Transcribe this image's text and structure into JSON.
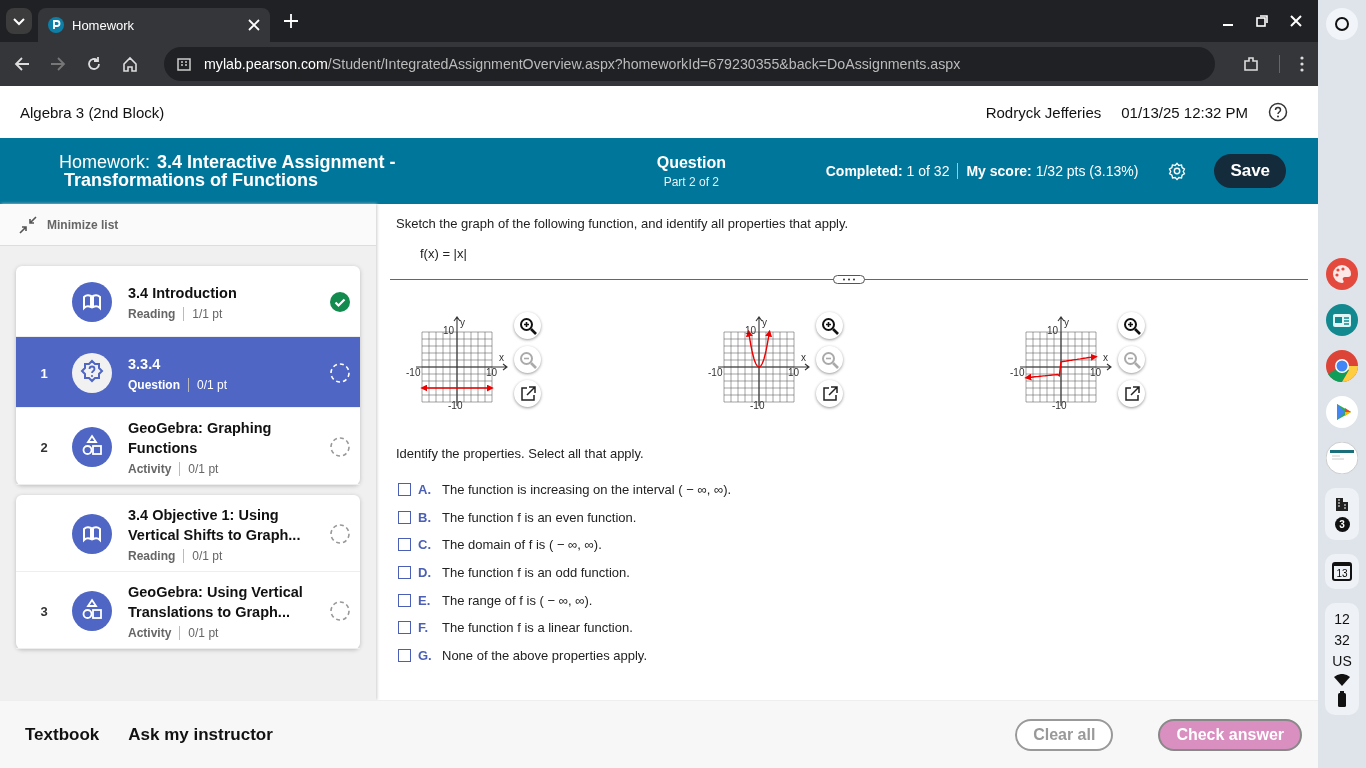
{
  "browser": {
    "tab": {
      "title": "Homework",
      "selected": true
    },
    "url_host": "mylab.pearson.com",
    "url_path": "/Student/IntegratedAssignmentOverview.aspx?homeworkId=679230355&back=DoAssignments.aspx"
  },
  "header": {
    "course": "Algebra 3 (2nd Block)",
    "user": "Rodryck Jefferies",
    "datetime": "01/13/25 12:32 PM"
  },
  "assignment_bar": {
    "prefix": "Homework:",
    "title": "3.4 Interactive Assignment -",
    "title_line2": "Transformations of Functions",
    "question_label": "Question",
    "part": "Part 2 of 2",
    "completed": "**Completed:** 1 of 32",
    "score": "**My score:** 1/32 pts (3.13%)",
    "save": "Save"
  },
  "sidebar": {
    "minimize": "Minimize list",
    "groups": [
      {
        "items": [
          {
            "kind": "reading",
            "title": "3.4 Introduction",
            "type": "Reading",
            "points": "1/1 pt",
            "complete": true,
            "selected": false
          },
          {
            "number": "1",
            "kind": "question",
            "title": "3.3.4",
            "type": "Question",
            "points": "0/1 pt",
            "complete": false,
            "selected": true
          },
          {
            "number": "2",
            "kind": "activity",
            "title": "GeoGebra: Graphing Functions",
            "type": "Activity",
            "points": "0/1 pt",
            "complete": false,
            "selected": false
          }
        ]
      },
      {
        "items": [
          {
            "kind": "reading",
            "title": "3.4 Objective 1: Using Vertical Shifts to Graph...",
            "type": "Reading",
            "points": "0/1 pt",
            "complete": false,
            "selected": false
          },
          {
            "number": "3",
            "kind": "activity",
            "title": "GeoGebra: Using Vertical Translations to Graph...",
            "type": "Activity",
            "points": "0/1 pt",
            "complete": false,
            "selected": false
          }
        ]
      }
    ]
  },
  "question": {
    "prompt": "Sketch the graph of the following function, and identify all properties that apply.",
    "function": "f(x) = |x|",
    "graphs": [
      {
        "kind": "constant",
        "x_label": "x",
        "y_label": "y",
        "x_min": "-10",
        "x_max": "10",
        "y_min": "-10",
        "y_max": "10"
      },
      {
        "kind": "parabola",
        "x_label": "x",
        "y_label": "y",
        "x_min": "-10",
        "x_max": "10",
        "y_min": "-10",
        "y_max": "10"
      },
      {
        "kind": "cubic",
        "x_label": "x",
        "y_label": "y",
        "x_min": "-10",
        "x_max": "10",
        "y_min": "-10",
        "y_max": "10"
      }
    ],
    "instruction": "Identify the properties. Select all that apply.",
    "options": [
      {
        "letter": "A.",
        "text": "The function is increasing on the interval ( − ∞, ∞).",
        "checked": false
      },
      {
        "letter": "B.",
        "text": "The function f is an even function.",
        "checked": false
      },
      {
        "letter": "C.",
        "text": "The domain of f is ( − ∞, ∞).",
        "checked": false
      },
      {
        "letter": "D.",
        "text": "The function f is an odd function.",
        "checked": false
      },
      {
        "letter": "E.",
        "text": "The range of f is ( − ∞, ∞).",
        "checked": false
      },
      {
        "letter": "F.",
        "text": "The function f is a linear function.",
        "checked": false
      },
      {
        "letter": "G.",
        "text": "None of the above properties apply.",
        "checked": false
      }
    ]
  },
  "footer": {
    "links": [
      "Textbook",
      "Ask my instructor"
    ],
    "buttons": [
      {
        "kind": "outline",
        "label": "Clear all",
        "disabled": true
      },
      {
        "kind": "filled",
        "label": "Check answer",
        "disabled": true
      }
    ]
  },
  "shelf": {
    "notifications": "3",
    "calendar_day": "13",
    "time_hour": "12",
    "time_minute": "32",
    "input_method": "US"
  }
}
